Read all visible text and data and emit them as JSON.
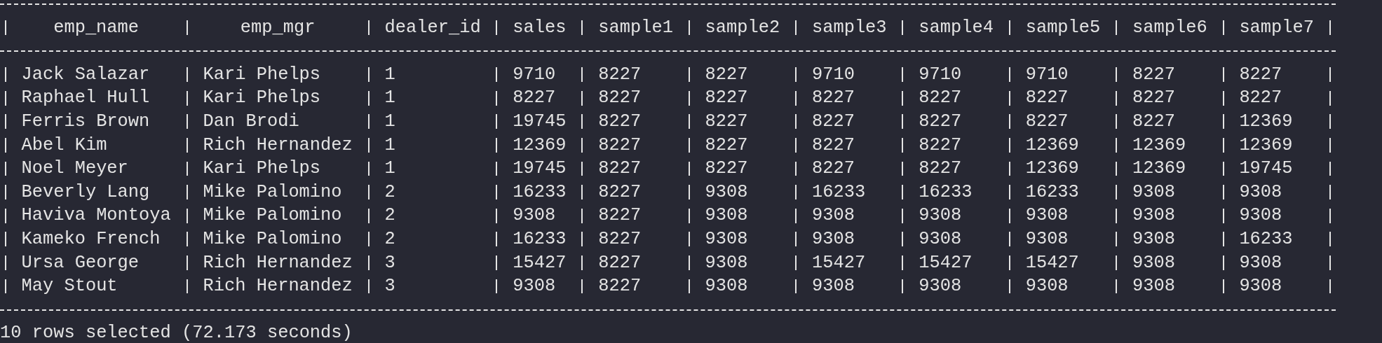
{
  "table": {
    "columns": [
      "emp_name",
      "emp_mgr",
      "dealer_id",
      "sales",
      "sample1",
      "sample2",
      "sample3",
      "sample4",
      "sample5",
      "sample6",
      "sample7"
    ],
    "rows": [
      [
        "Jack Salazar",
        "Kari Phelps",
        "1",
        "9710",
        "8227",
        "8227",
        "9710",
        "9710",
        "9710",
        "8227",
        "8227"
      ],
      [
        "Raphael Hull",
        "Kari Phelps",
        "1",
        "8227",
        "8227",
        "8227",
        "8227",
        "8227",
        "8227",
        "8227",
        "8227"
      ],
      [
        "Ferris Brown",
        "Dan Brodi",
        "1",
        "19745",
        "8227",
        "8227",
        "8227",
        "8227",
        "8227",
        "8227",
        "12369"
      ],
      [
        "Abel Kim",
        "Rich Hernandez",
        "1",
        "12369",
        "8227",
        "8227",
        "8227",
        "8227",
        "12369",
        "12369",
        "12369"
      ],
      [
        "Noel Meyer",
        "Kari Phelps",
        "1",
        "19745",
        "8227",
        "8227",
        "8227",
        "8227",
        "12369",
        "12369",
        "19745"
      ],
      [
        "Beverly Lang",
        "Mike Palomino",
        "2",
        "16233",
        "8227",
        "9308",
        "16233",
        "16233",
        "16233",
        "9308",
        "9308"
      ],
      [
        "Haviva Montoya",
        "Mike Palomino",
        "2",
        "9308",
        "8227",
        "9308",
        "9308",
        "9308",
        "9308",
        "9308",
        "9308"
      ],
      [
        "Kameko French",
        "Mike Palomino",
        "2",
        "16233",
        "8227",
        "9308",
        "9308",
        "9308",
        "9308",
        "9308",
        "16233"
      ],
      [
        "Ursa George",
        "Rich Hernandez",
        "3",
        "15427",
        "8227",
        "9308",
        "15427",
        "15427",
        "15427",
        "9308",
        "9308"
      ],
      [
        "May Stout",
        "Rich Hernandez",
        "3",
        "9308",
        "8227",
        "9308",
        "9308",
        "9308",
        "9308",
        "9308",
        "9308"
      ]
    ]
  },
  "status": "10 rows selected (72.173 seconds)"
}
